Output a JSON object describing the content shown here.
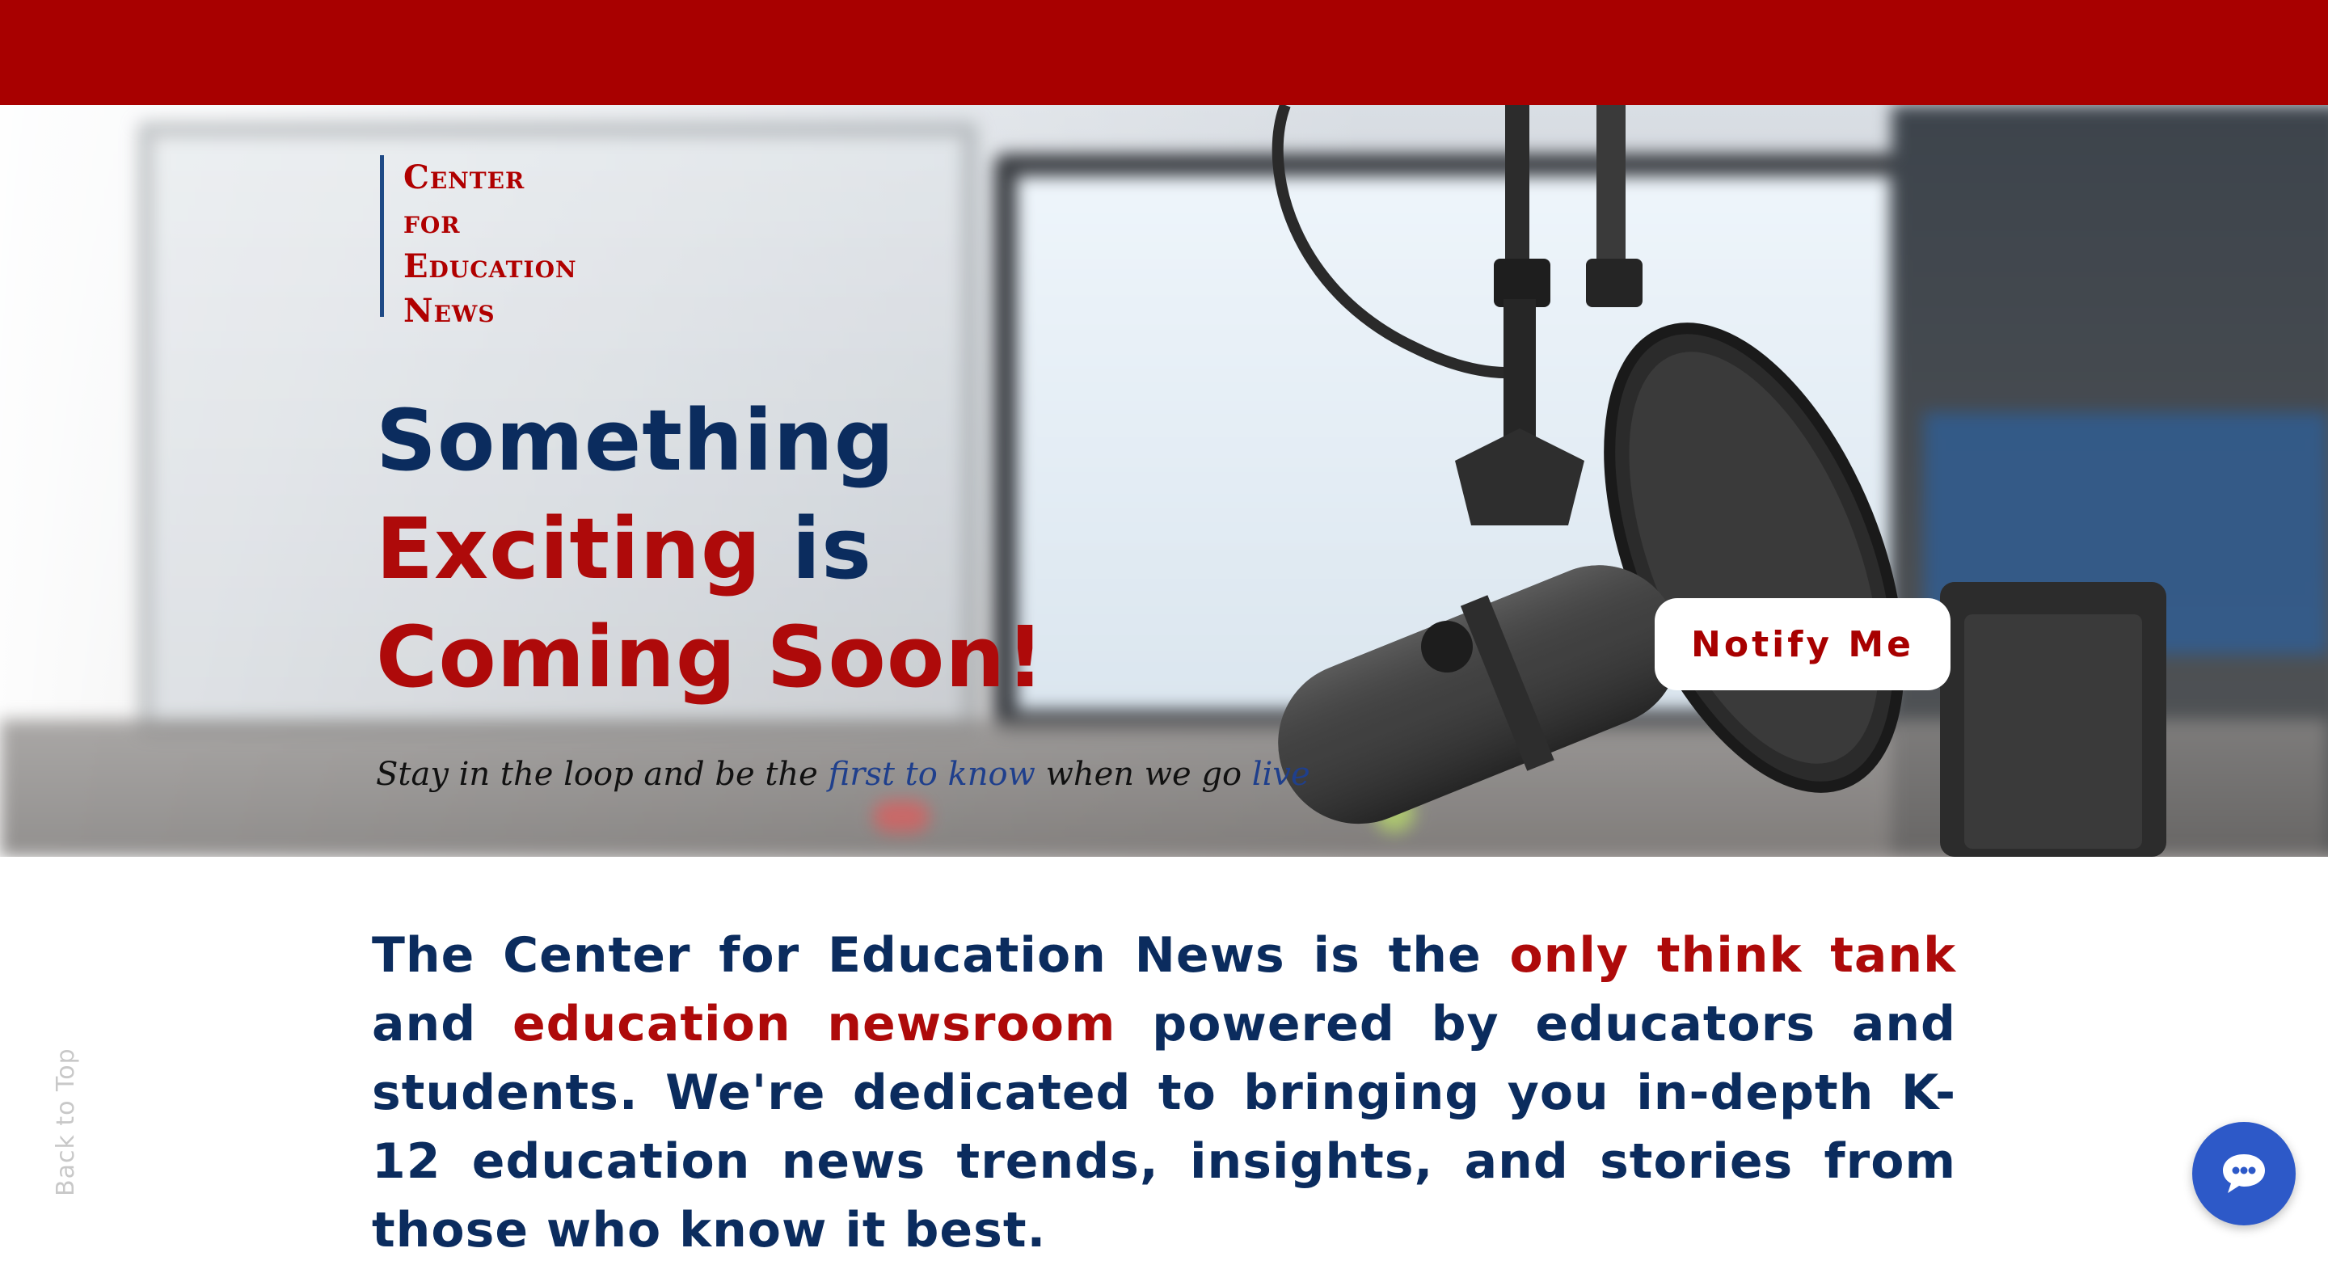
{
  "colors": {
    "brand_red": "#a80000",
    "navy": "#0b2c5e",
    "headline_red": "#ae0a0a",
    "chat_blue": "#2d59c8"
  },
  "logo": {
    "lines": [
      "Center",
      "for",
      "Education",
      "News"
    ]
  },
  "hero": {
    "headline": {
      "line1": "Something",
      "line2_red": "Exciting",
      "line2_rest": " is",
      "line3": "Coming Soon!"
    },
    "tagline": {
      "part1": "Stay in the loop and be the ",
      "part2_blue": "first to know",
      "part3": " when we go ",
      "part4_blue": "live"
    },
    "notify_button_label": "Notify Me",
    "image_icon": "studio-microphone"
  },
  "intro": {
    "part1": "The Center for Education News is the ",
    "part2_red": "only think tank",
    "part3": " and ",
    "part4_red": "education newsroom",
    "part5": " powered by educators and students. We're dedicated to bringing you in-depth K-12 education news trends, insights, and stories from those who know it best."
  },
  "back_to_top_label": "Back to Top",
  "chat": {
    "icon": "chat-bubble-icon"
  }
}
